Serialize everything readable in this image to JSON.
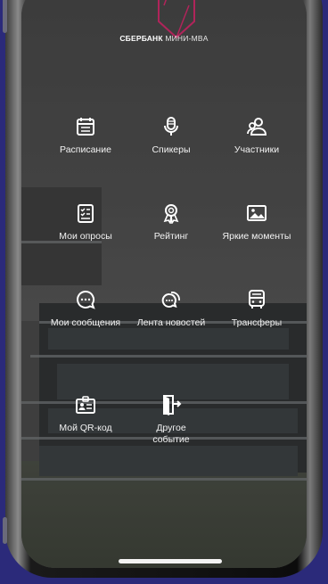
{
  "logo": {
    "brand": "СБЕРБАНК",
    "product": "МИНИ-MBA"
  },
  "menu": [
    {
      "label": "Расписание",
      "icon": "calendar-icon"
    },
    {
      "label": "Спикеры",
      "icon": "microphone-icon"
    },
    {
      "label": "Участники",
      "icon": "participants-icon"
    },
    {
      "label": "Мои опросы",
      "icon": "survey-icon"
    },
    {
      "label": "Рейтинг",
      "icon": "award-icon"
    },
    {
      "label": "Яркие моменты",
      "icon": "image-icon"
    },
    {
      "label": "Мои сообщения",
      "icon": "chat-icon"
    },
    {
      "label": "Лента новостей",
      "icon": "news-chat-icon"
    },
    {
      "label": "Трансферы",
      "icon": "bus-icon"
    },
    {
      "label": "Мой QR-код",
      "icon": "id-card-icon"
    },
    {
      "label": "Другое\nсобытие",
      "icon": "exit-door-icon"
    }
  ],
  "colors": {
    "background": "#2b2a7a",
    "logo_accent": "#b0245a",
    "text": "#ffffff"
  }
}
